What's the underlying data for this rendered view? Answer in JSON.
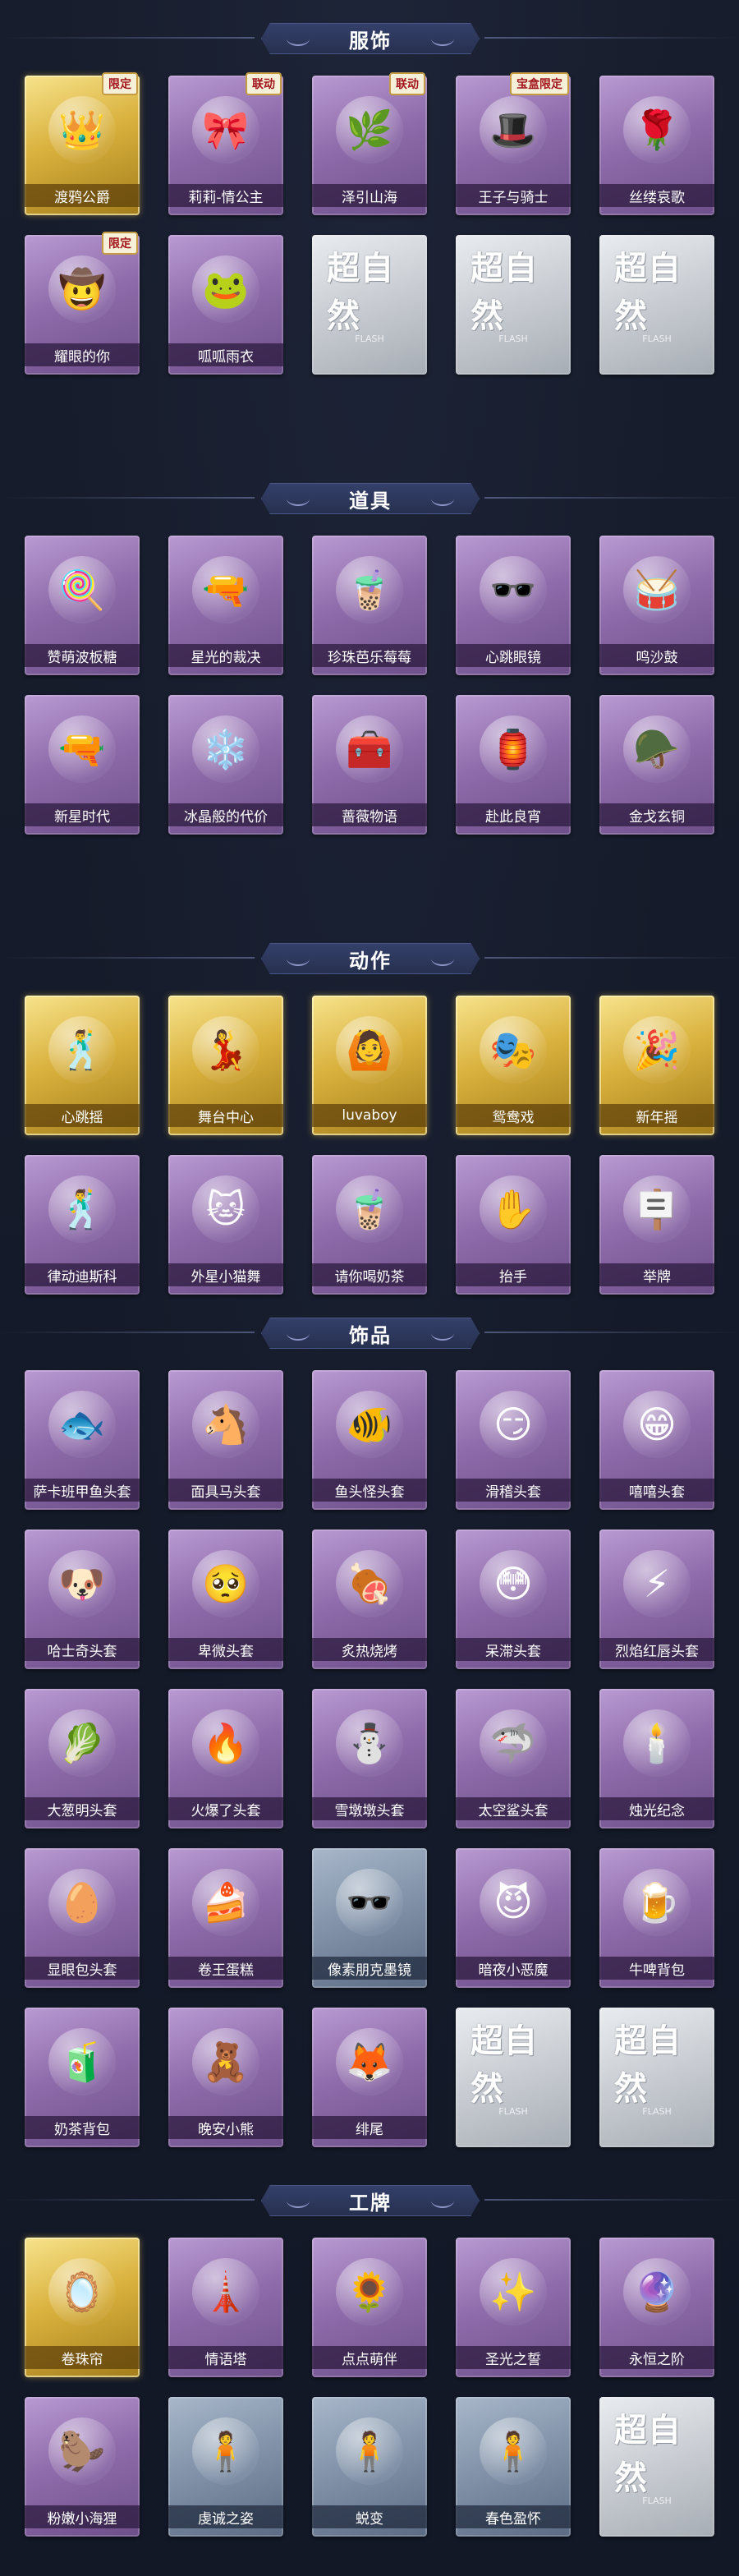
{
  "sections": [
    {
      "title": "服饰",
      "items": [
        {
          "label": "渡鸦公爵",
          "rarity": "gold",
          "icon": "👑",
          "badge": "限定"
        },
        {
          "label": "莉莉-情公主",
          "rarity": "purple",
          "icon": "🎀",
          "badge": "联动"
        },
        {
          "label": "泽引山海",
          "rarity": "purple",
          "icon": "🌿",
          "badge": "联动"
        },
        {
          "label": "王子与骑士",
          "rarity": "purple",
          "icon": "🎩",
          "badge": "宝盒限定"
        },
        {
          "label": "丝缕哀歌",
          "rarity": "purple",
          "icon": "🌹",
          "badge": ""
        },
        {
          "label": "耀眼的你",
          "rarity": "purple",
          "icon": "🤠",
          "badge": "限定"
        },
        {
          "label": "呱呱雨衣",
          "rarity": "purple",
          "icon": "🐸",
          "badge": ""
        },
        {
          "label": "",
          "rarity": "grey",
          "placeholder": "超自然",
          "placeholder_sub": "FLASH"
        },
        {
          "label": "",
          "rarity": "grey",
          "placeholder": "超自然",
          "placeholder_sub": "FLASH"
        },
        {
          "label": "",
          "rarity": "grey",
          "placeholder": "超自然",
          "placeholder_sub": "FLASH"
        }
      ]
    },
    {
      "title": "道具",
      "items": [
        {
          "label": "赞萌波板糖",
          "rarity": "purple",
          "icon": "🍭"
        },
        {
          "label": "星光的裁决",
          "rarity": "purple",
          "icon": "🔫"
        },
        {
          "label": "珍珠芭乐莓莓",
          "rarity": "purple",
          "icon": "🧋"
        },
        {
          "label": "心跳眼镜",
          "rarity": "purple",
          "icon": "🕶️"
        },
        {
          "label": "鸣沙鼓",
          "rarity": "purple",
          "icon": "🥁"
        },
        {
          "label": "新星时代",
          "rarity": "purple",
          "icon": "🔫"
        },
        {
          "label": "冰晶般的代价",
          "rarity": "purple",
          "icon": "❄️"
        },
        {
          "label": "蔷薇物语",
          "rarity": "purple",
          "icon": "🧰"
        },
        {
          "label": "赴此良宵",
          "rarity": "purple",
          "icon": "🏮"
        },
        {
          "label": "金戈玄铜",
          "rarity": "purple",
          "icon": "🪖"
        }
      ]
    },
    {
      "title": "动作",
      "items": [
        {
          "label": "心跳摇",
          "rarity": "gold",
          "icon": "🕺"
        },
        {
          "label": "舞台中心",
          "rarity": "gold",
          "icon": "💃"
        },
        {
          "label": "luvaboy",
          "rarity": "gold",
          "icon": "🙆"
        },
        {
          "label": "鸳鸯戏",
          "rarity": "gold",
          "icon": "🎭"
        },
        {
          "label": "新年摇",
          "rarity": "gold",
          "icon": "🎉"
        },
        {
          "label": "律动迪斯科",
          "rarity": "purple",
          "icon": "🕺"
        },
        {
          "label": "外星小猫舞",
          "rarity": "purple",
          "icon": "🐱"
        },
        {
          "label": "请你喝奶茶",
          "rarity": "purple",
          "icon": "🧋"
        },
        {
          "label": "抬手",
          "rarity": "purple",
          "icon": "✋"
        },
        {
          "label": "举牌",
          "rarity": "purple",
          "icon": "🪧"
        }
      ]
    },
    {
      "title": "饰品",
      "items": [
        {
          "label": "萨卡班甲鱼头套",
          "rarity": "purple",
          "icon": "🐟"
        },
        {
          "label": "面具马头套",
          "rarity": "purple",
          "icon": "🐴"
        },
        {
          "label": "鱼头怪头套",
          "rarity": "purple",
          "icon": "🐠"
        },
        {
          "label": "滑稽头套",
          "rarity": "purple",
          "icon": "😏"
        },
        {
          "label": "嘻嘻头套",
          "rarity": "purple",
          "icon": "😁"
        },
        {
          "label": "哈士奇头套",
          "rarity": "purple",
          "icon": "🐶"
        },
        {
          "label": "卑微头套",
          "rarity": "purple",
          "icon": "🥺"
        },
        {
          "label": "炙热烧烤",
          "rarity": "purple",
          "icon": "🍖"
        },
        {
          "label": "呆滞头套",
          "rarity": "purple",
          "icon": "😳"
        },
        {
          "label": "烈焰红唇头套",
          "rarity": "purple",
          "icon": "⚡"
        },
        {
          "label": "大葱明头套",
          "rarity": "purple",
          "icon": "🥬"
        },
        {
          "label": "火爆了头套",
          "rarity": "purple",
          "icon": "🔥"
        },
        {
          "label": "雪墩墩头套",
          "rarity": "purple",
          "icon": "⛄"
        },
        {
          "label": "太空鲨头套",
          "rarity": "purple",
          "icon": "🦈"
        },
        {
          "label": "烛光纪念",
          "rarity": "purple",
          "icon": "🕯️"
        },
        {
          "label": "显眼包头套",
          "rarity": "purple",
          "icon": "🥚"
        },
        {
          "label": "卷王蛋糕",
          "rarity": "purple",
          "icon": "🍰"
        },
        {
          "label": "像素朋克墨镜",
          "rarity": "blue",
          "icon": "🕶️"
        },
        {
          "label": "暗夜小恶魔",
          "rarity": "purple",
          "icon": "😈"
        },
        {
          "label": "牛啤背包",
          "rarity": "purple",
          "icon": "🍺"
        },
        {
          "label": "奶茶背包",
          "rarity": "purple",
          "icon": "🧃"
        },
        {
          "label": "晚安小熊",
          "rarity": "purple",
          "icon": "🧸"
        },
        {
          "label": "绯尾",
          "rarity": "purple",
          "icon": "🦊"
        },
        {
          "label": "",
          "rarity": "grey",
          "placeholder": "超自然",
          "placeholder_sub": "FLASH"
        },
        {
          "label": "",
          "rarity": "grey",
          "placeholder": "超自然",
          "placeholder_sub": "FLASH"
        }
      ]
    },
    {
      "title": "工牌",
      "items": [
        {
          "label": "卷珠帘",
          "rarity": "gold",
          "icon": "🪞"
        },
        {
          "label": "情语塔",
          "rarity": "purple",
          "icon": "🗼"
        },
        {
          "label": "点点萌伴",
          "rarity": "purple",
          "icon": "🌻"
        },
        {
          "label": "圣光之誓",
          "rarity": "purple",
          "icon": "✨"
        },
        {
          "label": "永恒之阶",
          "rarity": "purple",
          "icon": "🔮"
        },
        {
          "label": "粉嫩小海狸",
          "rarity": "purple",
          "icon": "🦫"
        },
        {
          "label": "虔诚之姿",
          "rarity": "blue",
          "icon": "🧍"
        },
        {
          "label": "蜕变",
          "rarity": "blue",
          "icon": "🧍"
        },
        {
          "label": "春色盈怀",
          "rarity": "blue",
          "icon": "🧍"
        },
        {
          "label": "",
          "rarity": "grey",
          "placeholder": "超自然",
          "placeholder_sub": "FLASH"
        }
      ]
    }
  ]
}
